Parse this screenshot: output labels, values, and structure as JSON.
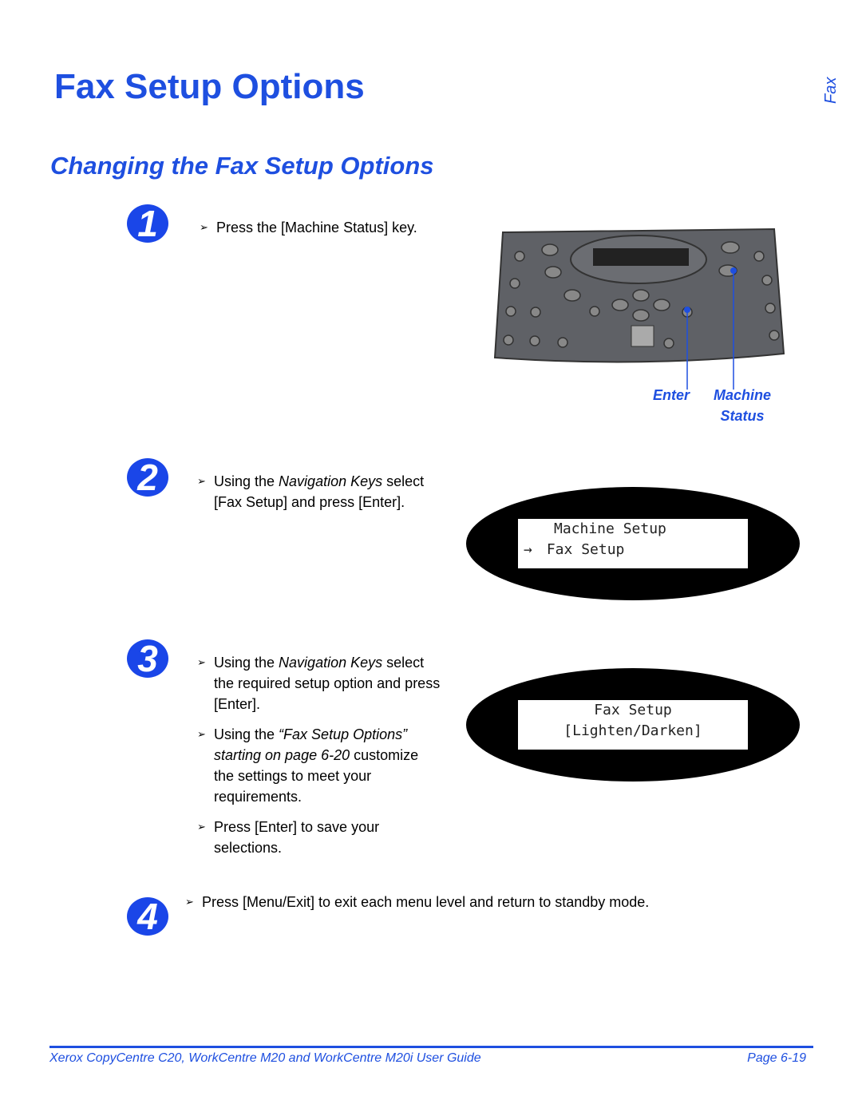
{
  "header": {
    "title": "Fax Setup Options",
    "section": "Changing the Fax Setup Options",
    "side_tab": "Fax"
  },
  "steps": [
    {
      "number": "1",
      "bullets": [
        [
          "Press the [Machine Status] key."
        ]
      ]
    },
    {
      "number": "2",
      "bullets": [
        [
          "Using the ",
          "Navigation Keys",
          " select [Fax Setup] and press [Enter]."
        ]
      ]
    },
    {
      "number": "3",
      "bullets": [
        [
          "Using the ",
          "Navigation Keys",
          " select the required setup option and press [Enter]."
        ],
        [
          "Using the ",
          "“Fax Setup Options” starting on page 6-20",
          " customize the settings to meet your requirements."
        ],
        [
          "Press [Enter] to save your selections."
        ]
      ]
    },
    {
      "number": "4",
      "bullets": [
        [
          "Press [Menu/Exit] to exit each menu level and return to standby mode."
        ]
      ]
    }
  ],
  "panel": {
    "labels": {
      "enter": "Enter",
      "machine_status_1": "Machine",
      "machine_status_2": "Status"
    }
  },
  "display1": {
    "line1": "Machine Setup",
    "arrow": "→",
    "line2": "Fax Setup"
  },
  "display2": {
    "line1": "Fax Setup",
    "line2": "[Lighten/Darken]"
  },
  "footer": {
    "left": "Xerox CopyCentre C20, WorkCentre M20 and WorkCentre M20i User Guide",
    "right": "Page 6-19"
  },
  "colors": {
    "accent": "#1e4fe0"
  }
}
